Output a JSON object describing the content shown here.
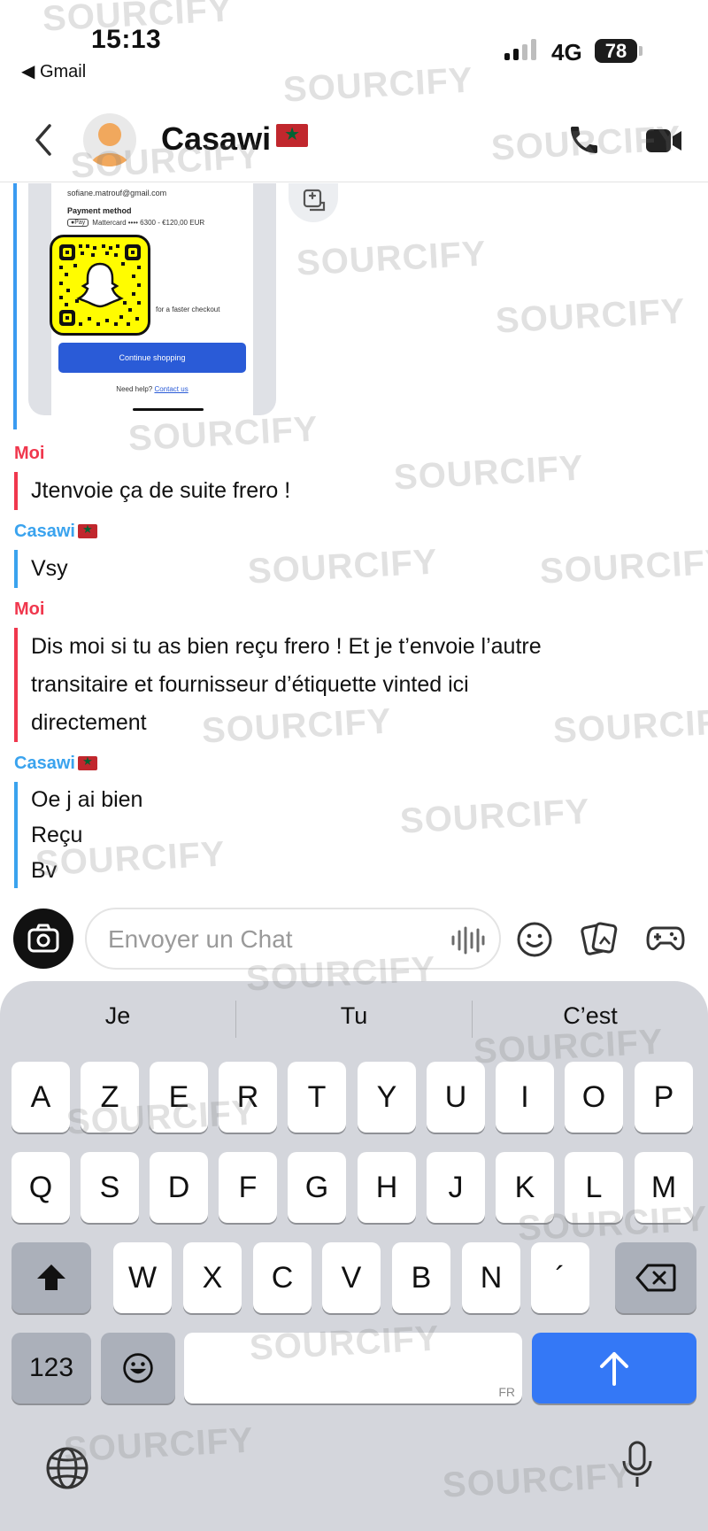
{
  "status_bar": {
    "time": "15:13",
    "back_app": "◀ Gmail",
    "network": "4G",
    "battery": "78"
  },
  "header": {
    "contact_name": "Casawi",
    "back_icon": "chevron-left-icon",
    "call_icon": "phone-icon",
    "video_icon": "video-icon"
  },
  "attachment": {
    "email": "sofiane.matrouf@gmail.com",
    "payment_method_label": "Payment method",
    "pay_badge": "●Pay",
    "card_line": "Mattercard •••• 6300 - €120,00 EUR",
    "faster_checkout": "for a faster checkout",
    "continue_button": "Continue shopping",
    "help_text": "Need help?",
    "help_link": "Contact us"
  },
  "messages": [
    {
      "sender": "Moi",
      "lines": [
        "Jtenvoie ça de suite frero !"
      ]
    },
    {
      "sender": "Casawi",
      "lines": [
        "Vsy"
      ]
    },
    {
      "sender": "Moi",
      "lines": [
        "Dis moi si tu as bien reçu frero ! Et je t’envoie l’autre",
        "transitaire et fournisseur d’étiquette vinted ici",
        "directement"
      ]
    },
    {
      "sender": "Casawi",
      "lines": [
        "Oe j ai bien",
        "Reçu",
        "Bv"
      ]
    }
  ],
  "input_bar": {
    "placeholder": "Envoyer un Chat",
    "value": ""
  },
  "keyboard": {
    "suggestions": [
      "Je",
      "Tu",
      "C’est"
    ],
    "row1": [
      "A",
      "Z",
      "E",
      "R",
      "T",
      "Y",
      "U",
      "I",
      "O",
      "P"
    ],
    "row2": [
      "Q",
      "S",
      "D",
      "F",
      "G",
      "H",
      "J",
      "K",
      "L",
      "M"
    ],
    "row3": [
      "W",
      "X",
      "C",
      "V",
      "B",
      "N",
      "´"
    ],
    "numbers_key": "123",
    "language": "FR"
  },
  "watermark": "SOURCIFY",
  "colors": {
    "me": "#f0374d",
    "them": "#3aa3ee",
    "send": "#3478f6",
    "keyboard_bg": "#d4d6dc"
  }
}
